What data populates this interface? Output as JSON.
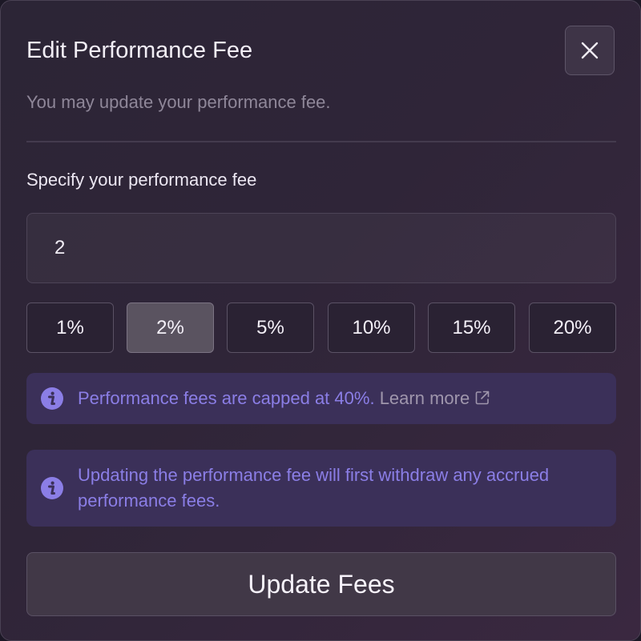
{
  "dialog": {
    "title": "Edit Performance Fee",
    "subtitle": "You may update your performance fee.",
    "close_icon": "close-icon"
  },
  "fee_field": {
    "label": "Specify your performance fee",
    "value": "2"
  },
  "presets": [
    {
      "label": "1%",
      "selected": false
    },
    {
      "label": "2%",
      "selected": true
    },
    {
      "label": "5%",
      "selected": false
    },
    {
      "label": "10%",
      "selected": false
    },
    {
      "label": "15%",
      "selected": false
    },
    {
      "label": "20%",
      "selected": false
    }
  ],
  "notices": {
    "cap": {
      "text": "Performance fees are capped at 40%.",
      "link": "Learn more",
      "icon": "info-icon",
      "link_icon": "external-link-icon"
    },
    "withdraw": {
      "text": "Updating the performance fee will first withdraw any accrued performance fees.",
      "icon": "info-icon"
    }
  },
  "actions": {
    "update_label": "Update Fees"
  },
  "colors": {
    "accent": "#8b7ee6",
    "notice_bg": "#3b3059",
    "selected_preset_bg": "#5a5360"
  }
}
